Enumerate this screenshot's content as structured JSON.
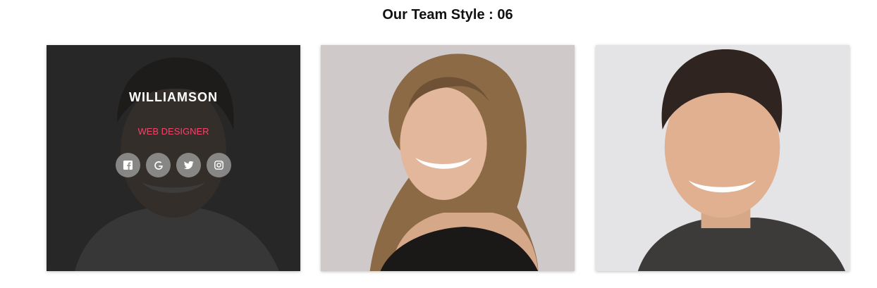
{
  "page": {
    "title": "Our Team Style : 06"
  },
  "colors": {
    "accent": "#f2446b",
    "overlay": "#1c1c1c",
    "social_bg": "#969696"
  },
  "team": [
    {
      "name": "WILLIAMSON",
      "role": "WEB DESIGNER",
      "photo": "smiling man with dark hair in white shirt",
      "social": [
        "facebook-icon",
        "google-icon",
        "twitter-icon",
        "instagram-icon"
      ]
    },
    {
      "photo": "smiling woman with curly auburn hair in black top"
    },
    {
      "photo": "smiling man with short dark hair in dark t-shirt"
    }
  ]
}
